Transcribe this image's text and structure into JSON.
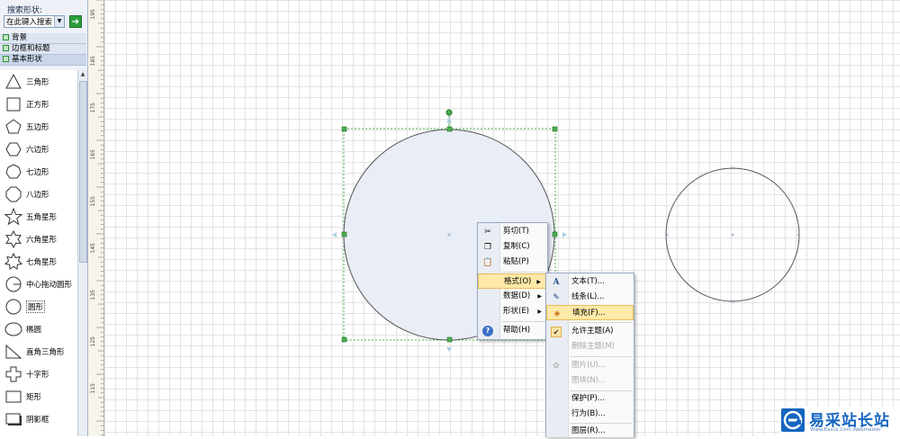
{
  "panel": {
    "search_label": "搜索形状:",
    "search_placeholder": "在此键入搜索",
    "stencils": [
      "背景",
      "边框和标题",
      "基本形状"
    ],
    "shapes": [
      {
        "label": "三角形",
        "icon": "triangle-icon"
      },
      {
        "label": "正方形",
        "icon": "square-icon"
      },
      {
        "label": "五边形",
        "icon": "pentagon-icon"
      },
      {
        "label": "六边形",
        "icon": "hexagon-icon"
      },
      {
        "label": "七边形",
        "icon": "heptagon-icon"
      },
      {
        "label": "八边形",
        "icon": "octagon-icon"
      },
      {
        "label": "五角星形",
        "icon": "star5-icon"
      },
      {
        "label": "六角星形",
        "icon": "star6-icon"
      },
      {
        "label": "七角星形",
        "icon": "star7-icon"
      },
      {
        "label": "中心拖动圆形",
        "icon": "center-drag-circle-icon"
      },
      {
        "label": "圆形",
        "icon": "circle-icon",
        "selected": true
      },
      {
        "label": "椭圆",
        "icon": "ellipse-icon"
      },
      {
        "label": "直角三角形",
        "icon": "right-triangle-icon"
      },
      {
        "label": "十字形",
        "icon": "cross-icon"
      },
      {
        "label": "矩形",
        "icon": "rectangle-icon"
      },
      {
        "label": "阴影框",
        "icon": "shadow-box-icon"
      }
    ]
  },
  "ruler": {
    "labels": [
      "195",
      "185",
      "175",
      "165",
      "155",
      "145",
      "135",
      "125",
      "115"
    ]
  },
  "context_menu": {
    "items": [
      {
        "label": "剪切(T)",
        "icon": "scissors-icon"
      },
      {
        "label": "复制(C)",
        "icon": "copy-icon"
      },
      {
        "label": "粘贴(P)",
        "icon": "paste-icon"
      },
      {
        "label": "格式(O)",
        "submenu": true,
        "highlighted": true
      },
      {
        "label": "数据(D)",
        "submenu": true
      },
      {
        "label": "形状(E)",
        "submenu": true
      },
      {
        "label": "帮助(H)",
        "icon": "help-icon"
      }
    ]
  },
  "format_submenu": {
    "items": [
      {
        "label": "文本(T)...",
        "icon": "text-icon"
      },
      {
        "label": "线条(L)...",
        "icon": "line-icon"
      },
      {
        "label": "填充(F)...",
        "icon": "fill-icon",
        "highlighted": true
      },
      {
        "label": "允许主题(A)",
        "icon": "check-icon"
      },
      {
        "label": "删除主题(M)",
        "disabled": true
      },
      {
        "label": "图片(U)...",
        "icon": "picture-icon",
        "disabled": true
      },
      {
        "label": "图块(N)...",
        "disabled": true
      },
      {
        "label": "保护(P)..."
      },
      {
        "label": "行为(B)..."
      },
      {
        "label": "图层(R)..."
      }
    ]
  },
  "watermark": {
    "title": "易采站长站",
    "subtitle": "Www.Easck.Com  Webmaster"
  },
  "colors": {
    "circle_fill": "#e8edf6",
    "handle": "#2a9d3a",
    "highlight": "#fde9a8"
  }
}
